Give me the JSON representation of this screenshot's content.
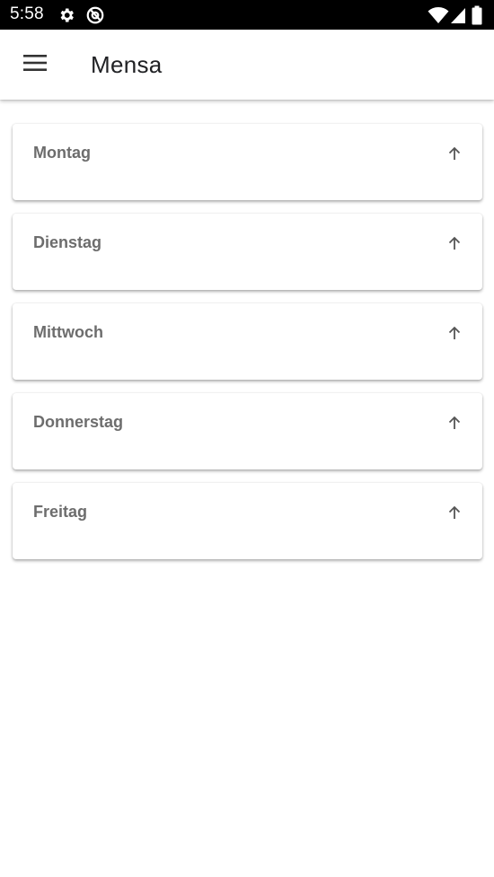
{
  "status_bar": {
    "time": "5:58",
    "icons": [
      "gear-icon",
      "at-sign-icon",
      "wifi-icon",
      "signal-icon",
      "battery-icon"
    ]
  },
  "app_bar": {
    "title": "Mensa",
    "menu_icon": "hamburger-menu-icon"
  },
  "days": [
    {
      "label": "Montag",
      "icon": "arrow-up-icon"
    },
    {
      "label": "Dienstag",
      "icon": "arrow-up-icon"
    },
    {
      "label": "Mittwoch",
      "icon": "arrow-up-icon"
    },
    {
      "label": "Donnerstag",
      "icon": "arrow-up-icon"
    },
    {
      "label": "Freitag",
      "icon": "arrow-up-icon"
    }
  ],
  "colors": {
    "status_bar_bg": "#000000",
    "app_bar_bg": "#ffffff",
    "title_text": "#202124",
    "card_text": "#6d6d6d",
    "icon": "#555555"
  }
}
